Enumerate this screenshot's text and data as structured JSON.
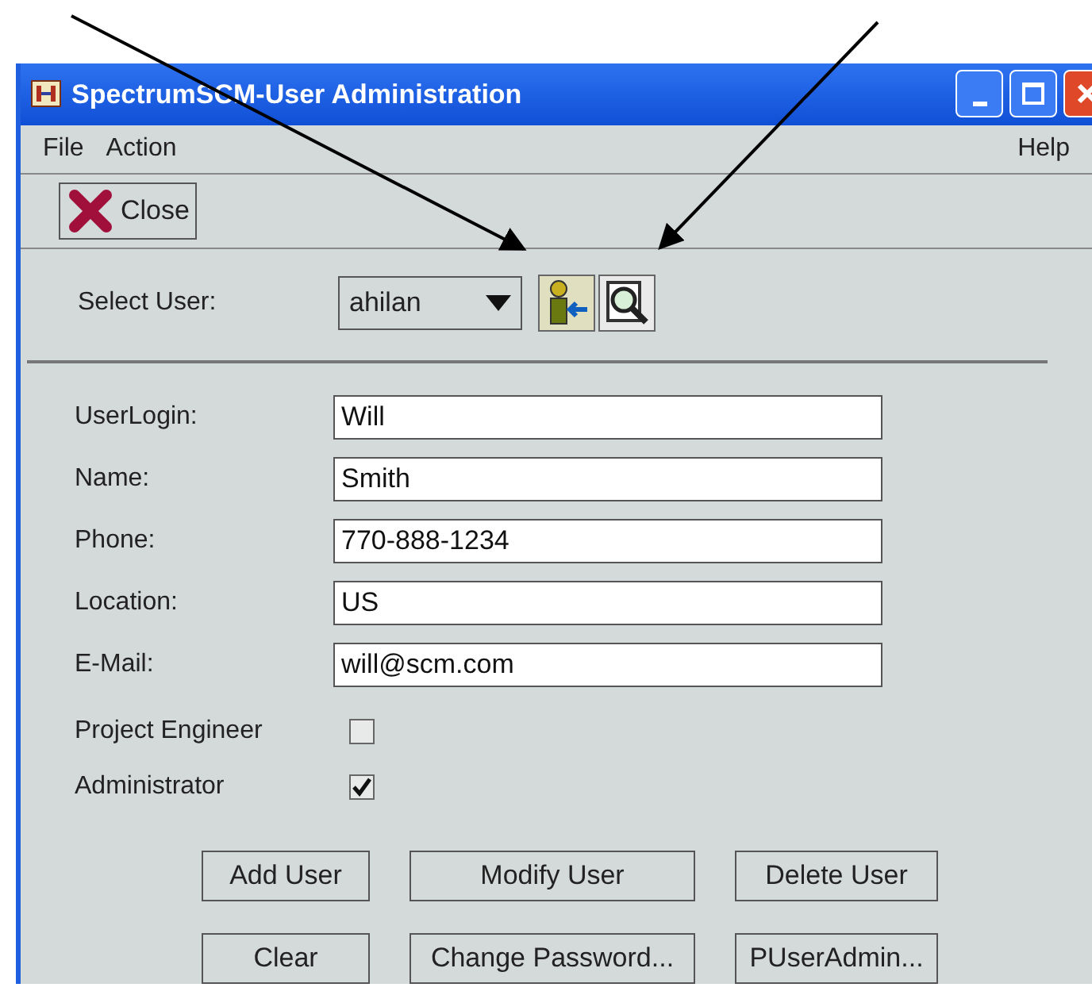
{
  "window": {
    "title": "SpectrumSCM-User Administration"
  },
  "menu": {
    "left": [
      "File",
      "Action"
    ],
    "right": "Help"
  },
  "toolbar": {
    "close_button": "Close"
  },
  "select_user": {
    "label": "Select User:",
    "value": "ahilan"
  },
  "fields": [
    {
      "label": "UserLogin:",
      "value": "Will"
    },
    {
      "label": "Name:",
      "value": "Smith"
    },
    {
      "label": "Phone:",
      "value": "770-888-1234"
    },
    {
      "label": "Location:",
      "value": "US"
    },
    {
      "label": "E-Mail:",
      "value": "will@scm.com"
    }
  ],
  "checkboxes": [
    {
      "label": "Project Engineer",
      "checked": false
    },
    {
      "label": "Administrator",
      "checked": true
    }
  ],
  "buttons": [
    [
      "Add User",
      "Modify User",
      "Delete User"
    ],
    [
      "Clear",
      "Change Password...",
      "PUserAdmin..."
    ]
  ]
}
